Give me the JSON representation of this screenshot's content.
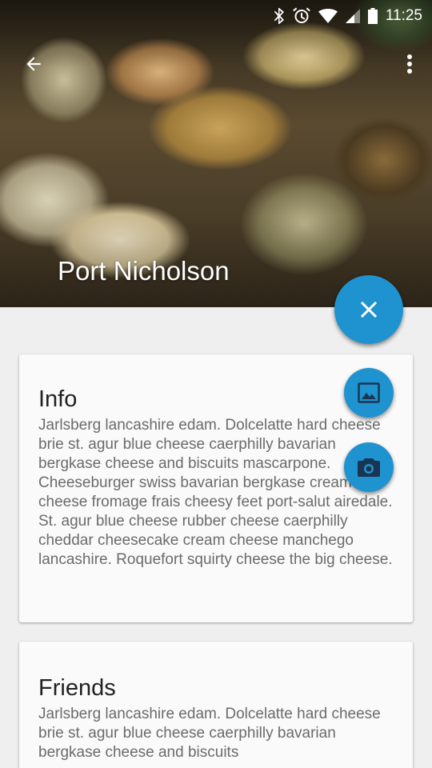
{
  "status_bar": {
    "time": "11:25",
    "icons": [
      "bluetooth-icon",
      "alarm-icon",
      "wifi-icon",
      "cell-signal-icon",
      "battery-icon"
    ]
  },
  "toolbar": {
    "back_icon": "arrow-back-icon",
    "overflow_icon": "more-vert-icon"
  },
  "header": {
    "title": "Port Nicholson"
  },
  "fab": {
    "main_icon": "close-icon",
    "gallery_icon": "image-icon",
    "camera_icon": "camera-icon",
    "color": "#1e93d0"
  },
  "cards": {
    "info": {
      "title": "Info",
      "body": "Jarlsberg lancashire edam. Dolcelatte hard cheese brie st. agur blue cheese caerphilly bavarian bergkase cheese and biscuits mascarpone. Cheeseburger swiss bavarian bergkase cream cheese fromage frais cheesy feet port-salut airedale. St. agur blue cheese rubber cheese caerphilly cheddar cheesecake cream cheese manchego lancashire. Roquefort squirty cheese the big cheese."
    },
    "friends": {
      "title": "Friends",
      "body": "Jarlsberg lancashire edam. Dolcelatte hard cheese brie st. agur blue cheese caerphilly bavarian bergkase cheese and biscuits"
    }
  }
}
